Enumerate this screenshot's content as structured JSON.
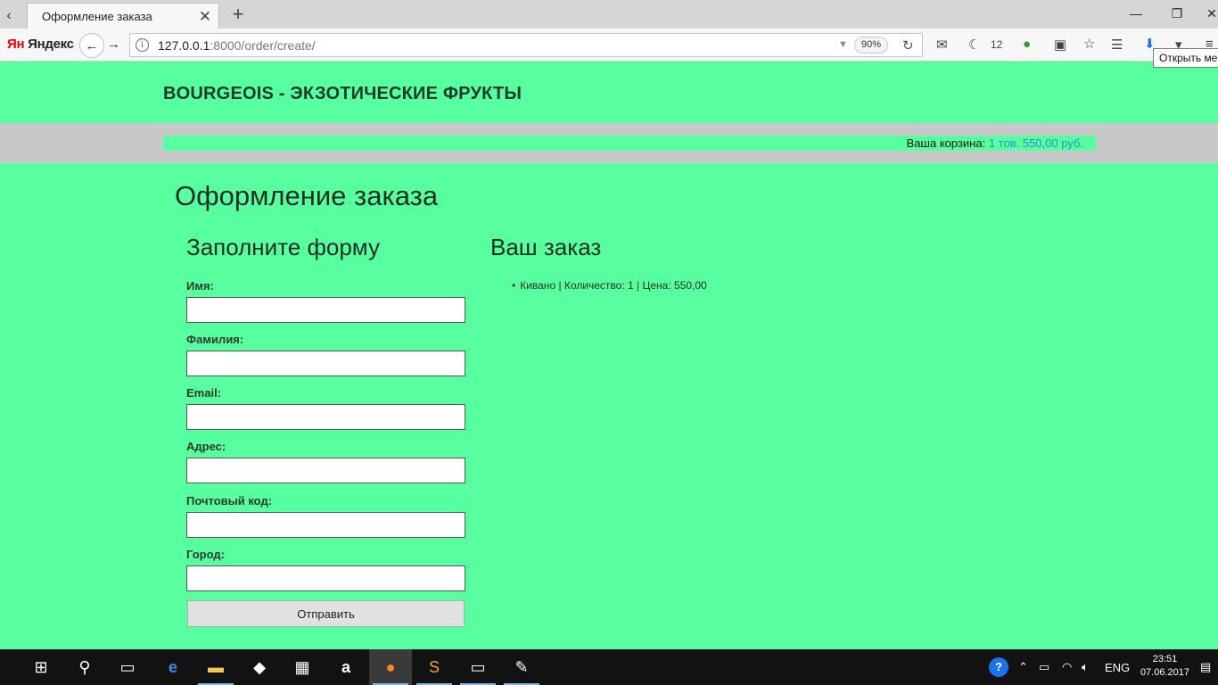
{
  "browser": {
    "tab_title": "Оформление заказа",
    "new_tab_symbol": "+",
    "close_symbol": "✕",
    "search_engine_logo": "Яндекс",
    "search_engine_logo_prefix": "Ян",
    "url_host": "127.0.0.1",
    "url_rest": ":8000/order/create/",
    "zoom": "90%",
    "notification_count": "12",
    "tooltip": "Открыть ме"
  },
  "site": {
    "logo": "BOURGEOIS - ЭКЗОТИЧЕСКИЕ ФРУКТЫ",
    "cart_label": "Ваша корзина:",
    "cart_summary": "1 тов. 550,00 руб."
  },
  "page": {
    "title": "Оформление заказа",
    "form_title": "Заполните форму",
    "order_title": "Ваш заказ",
    "fields": [
      {
        "label": "Имя:",
        "value": ""
      },
      {
        "label": "Фамилия:",
        "value": ""
      },
      {
        "label": "Email:",
        "value": ""
      },
      {
        "label": "Адрес:",
        "value": ""
      },
      {
        "label": "Почтовый код:",
        "value": ""
      },
      {
        "label": "Город:",
        "value": ""
      }
    ],
    "submit_label": "Отправить",
    "order_items": [
      "Кивано | Количество: 1 | Цена: 550,00"
    ]
  },
  "taskbar": {
    "language": "ENG",
    "time": "23:51",
    "date": "07.06.2017"
  },
  "colors": {
    "page_bg": "#57ff9e",
    "subheader_bg": "#c8c8c8",
    "cart_link": "#2d8ad6"
  }
}
